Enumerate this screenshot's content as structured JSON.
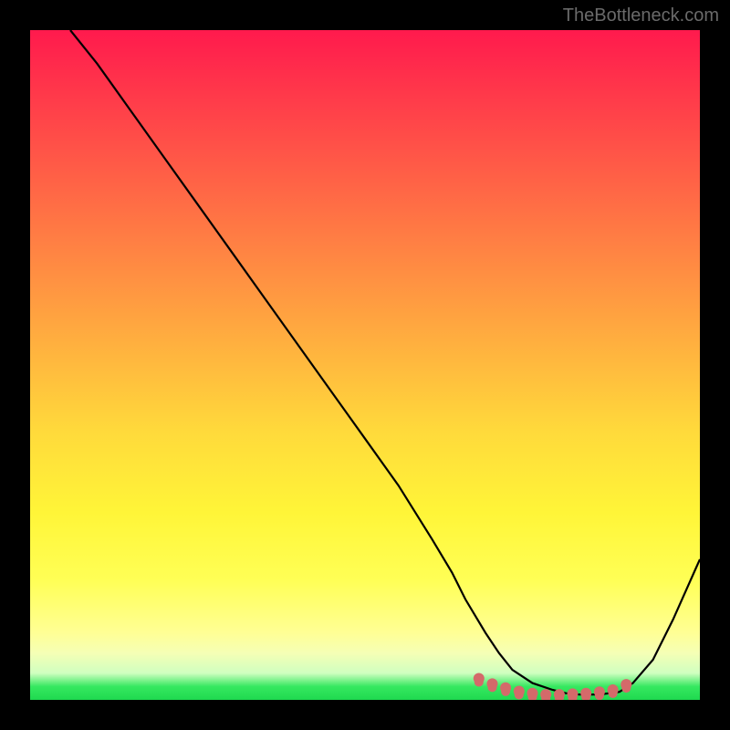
{
  "watermark": "TheBottleneck.com",
  "chart_data": {
    "type": "line",
    "title": "",
    "xlabel": "",
    "ylabel": "",
    "xlim": [
      0,
      100
    ],
    "ylim": [
      0,
      100
    ],
    "series": [
      {
        "name": "bottleneck-curve",
        "x": [
          6,
          10,
          15,
          20,
          25,
          30,
          35,
          40,
          45,
          50,
          55,
          60,
          63,
          65,
          68,
          70,
          72,
          75,
          78,
          80,
          82,
          85,
          88,
          90,
          93,
          96,
          100
        ],
        "y": [
          100,
          95,
          88,
          81,
          74,
          67,
          60,
          53,
          46,
          39,
          32,
          24,
          19,
          15,
          10,
          7,
          4.5,
          2.5,
          1.5,
          1.0,
          0.8,
          0.8,
          1.2,
          2.5,
          6,
          12,
          21
        ]
      }
    ],
    "markers": {
      "name": "optimal-band",
      "color": "#d46a6a",
      "x": [
        67,
        69,
        71,
        73,
        75,
        77,
        79,
        81,
        83,
        85,
        87,
        89
      ],
      "y": [
        3.2,
        2.4,
        1.8,
        1.3,
        1.0,
        0.8,
        0.8,
        0.9,
        1.0,
        1.2,
        1.5,
        2.3
      ]
    },
    "colors": {
      "curve": "#000000",
      "marker": "#d46a6a",
      "gradient_top": "#ff1a4d",
      "gradient_mid": "#ffda3b",
      "gradient_bottom": "#1fd94f"
    }
  }
}
